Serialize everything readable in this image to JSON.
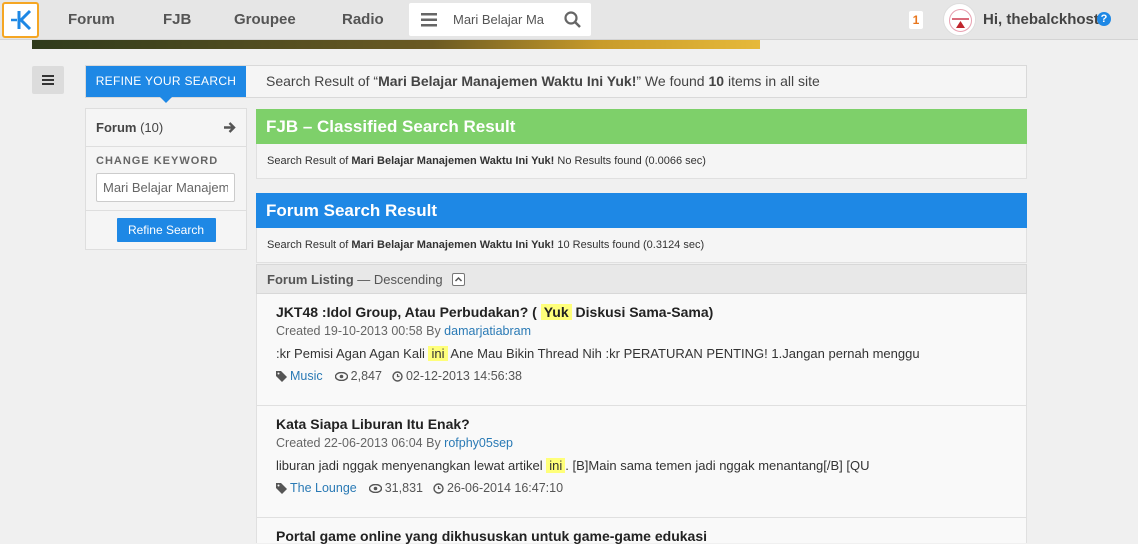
{
  "nav": {
    "forum": "Forum",
    "fjb": "FJB",
    "groupee": "Groupee",
    "radio": "Radio",
    "search_value": "Mari Belajar Ma",
    "notif_count": "1",
    "greeting": "Hi, thebalckhost",
    "help": "?"
  },
  "refine": {
    "tab_label": "REFINE YOUR SEARCH",
    "result_prefix": "Search Result of “",
    "query": "Mari Belajar Manajemen Waktu Ini Yuk!",
    "result_mid": "” We found ",
    "count": "10",
    "result_suffix": " items in all site"
  },
  "left_panel": {
    "forum_label": "Forum",
    "forum_count": "(10)",
    "change_keyword": "CHANGE KEYWORD",
    "keyword_value": "Mari Belajar Manajemen",
    "refine_button": "Refine Search"
  },
  "fjb": {
    "title": "FJB – Classified Search Result",
    "sub_prefix": "Search Result of ",
    "query": "Mari Belajar Manajemen Waktu Ini Yuk!",
    "sub_suffix": "  No Results found (0.0066 sec)",
    "color": "#7ed06a"
  },
  "forum": {
    "title": "Forum Search Result",
    "sub_prefix": "Search Result of ",
    "query": "Mari Belajar Manajemen Waktu Ini Yuk!",
    "sub_suffix": " 10 Results found (0.3124 sec)",
    "color": "#1e88e5",
    "listing_label": "Forum Listing",
    "listing_order": " — Descending"
  },
  "items": [
    {
      "title_pre": "JKT48 :Idol Group, Atau Perbudakan? ( ",
      "title_hl": "Yuk",
      "title_post": " Diskusi Sama-Sama)",
      "created": "Created 19-10-2013 00:58 By ",
      "author": "damarjatiabram",
      "snip_pre": ":kr Pemisi Agan Agan Kali ",
      "snip_hl": "ini",
      "snip_post": " Ane Mau Bikin Thread Nih :kr PERATURAN PENTING! 1.Jangan pernah menggu",
      "tag": "Music",
      "views": "2,847",
      "last": "02-12-2013 14:56:38"
    },
    {
      "title_pre": "Kata Siapa Liburan Itu Enak?",
      "title_hl": "",
      "title_post": "",
      "created": "Created 22-06-2013 06:04 By ",
      "author": "rofphy05sep",
      "snip_pre": "liburan jadi nggak menyenangkan lewat artikel ",
      "snip_hl": "ini",
      "snip_post": ". [B]Main sama temen jadi nggak menantang[/B] [QU",
      "tag": "The Lounge",
      "views": "31,831",
      "last": "26-06-2014 16:47:10"
    },
    {
      "title_pre": "Portal game online yang dikhususkan untuk game-game edukasi",
      "title_hl": "",
      "title_post": ""
    }
  ]
}
